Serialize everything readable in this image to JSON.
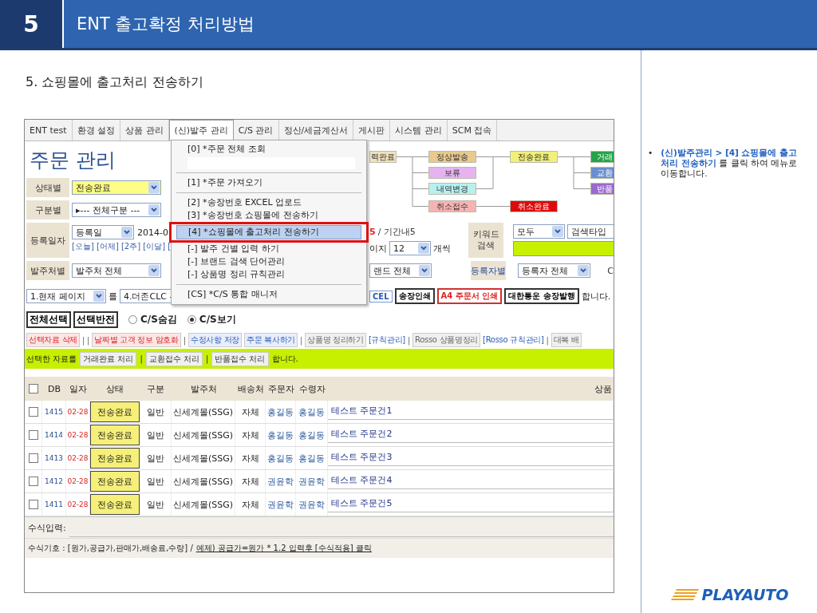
{
  "slide": {
    "number": "5",
    "title": "ENT 출고확정 처리방법"
  },
  "heading": "5. 쇼핑몰에 출고처리 전송하기",
  "app": {
    "nav_tabs": [
      {
        "label": "ENT test",
        "selected": false
      },
      {
        "label": "환경 설정",
        "selected": false
      },
      {
        "label": "상품 관리",
        "selected": false
      },
      {
        "label": "(신)발주 관리",
        "selected": true
      },
      {
        "label": "C/S 관리",
        "selected": false
      },
      {
        "label": "정산/세금계산서",
        "selected": false
      },
      {
        "label": "게시판",
        "selected": false
      },
      {
        "label": "시스템 관리",
        "selected": false
      },
      {
        "label": "SCM 접속",
        "selected": false
      }
    ],
    "page_title": "주문 관리",
    "menu": [
      {
        "kind": "item",
        "label": "[0] *주문 전체 조회",
        "selected": false
      },
      {
        "kind": "blank"
      },
      {
        "kind": "divider"
      },
      {
        "kind": "item",
        "label": "[1] *주문 가져오기",
        "selected": false
      },
      {
        "kind": "divider"
      },
      {
        "kind": "item",
        "label": "[2] *송장번호 EXCEL 업로드",
        "selected": false
      },
      {
        "kind": "item",
        "label": "[3] *송장번호 쇼핑몰에 전송하기",
        "selected": false
      },
      {
        "kind": "item",
        "label": "[4] *쇼핑몰에 출고처리 전송하기",
        "selected": true
      },
      {
        "kind": "item",
        "label": "[-] 발주 건별 입력 하기",
        "selected": false
      },
      {
        "kind": "item",
        "label": "[-] 브랜드 검색 단어관리",
        "selected": false
      },
      {
        "kind": "item",
        "label": "[-] 상품명 정리 규칙관리",
        "selected": false
      },
      {
        "kind": "divider"
      },
      {
        "kind": "item",
        "label": "[CS] *C/S 통합 매니저",
        "selected": false
      }
    ],
    "status_filter": {
      "label": "상태별",
      "value": "전송완료"
    },
    "type_filter": {
      "label": "구분별",
      "value": "▸--- 전체구분 ---"
    },
    "date_filter": {
      "label": "등록일자",
      "value": "등록일",
      "date": "2014-0",
      "shortcuts": "[오늘] [어제] [2주] [이달] ["
    },
    "vendor_filter": {
      "label": "발주처별",
      "value": "발주처 전체"
    },
    "page_action": {
      "scope": "1.현재 페이지",
      "particle": "를",
      "target": "4.더존CLC -"
    },
    "flow": [
      [
        {
          "label": "력완료",
          "color": "#f1e2bd",
          "kind": "main"
        }
      ],
      [
        {
          "label": "정상발송",
          "color": "#e8c98e",
          "kind": "main"
        },
        {
          "label": "보류",
          "color": "#e6b3f0",
          "kind": "main"
        },
        {
          "label": "내역변경",
          "color": "#b8f0f0",
          "kind": "main"
        },
        {
          "label": "취소접수",
          "color": "#f7b3b3",
          "kind": "cancel"
        }
      ],
      [
        {
          "label": "전송완료",
          "color": "#f2f07a",
          "kind": "main"
        },
        {
          "label": "취소완료",
          "color": "#dd0a0a",
          "kind": "cancel"
        }
      ],
      [
        {
          "label": "거래",
          "color": "#22a548",
          "kind": "main"
        },
        {
          "label": "교환",
          "color": "#6a8fd0",
          "kind": "main"
        },
        {
          "label": "반품",
          "color": "#9b6ad0",
          "kind": "main"
        }
      ]
    ],
    "summary": {
      "count": "5",
      "period": "/ 기간내5"
    },
    "per_page": {
      "prefix": "이지",
      "value": "12",
      "suffix": "개씩"
    },
    "keyword": {
      "label": "키워드 검색",
      "scope": "모두",
      "type": "검색타입"
    },
    "brand_filter": {
      "value": "랜드 전체"
    },
    "registrant_filter": {
      "label": "등록자별",
      "value": "등록자 전체",
      "extra": "C"
    },
    "print_buttons": [
      {
        "label": "CEL",
        "kind": "link"
      },
      {
        "label": "송장인쇄",
        "kind": "print"
      },
      {
        "label": "A4 주문서 인쇄",
        "kind": "alert"
      },
      {
        "label": "대한통운 송장발행",
        "kind": "print"
      }
    ],
    "print_suffix": "합니다.",
    "select_buttons": [
      "전체선택",
      "선택반전"
    ],
    "cs_radios": [
      {
        "label": "C/S숨김",
        "selected": false
      },
      {
        "label": "C/S보기",
        "selected": true
      }
    ],
    "actions": [
      {
        "label": "선택자료 삭제",
        "kind": "danger"
      },
      {
        "label": "| |",
        "kind": "separator"
      },
      {
        "label": "날짜별 고객 정보 암호화",
        "kind": "danger"
      },
      {
        "label": "|",
        "kind": "separator"
      },
      {
        "label": "수정사항 저장",
        "kind": "primary"
      },
      {
        "label": "주문 복사하기",
        "kind": "primary"
      },
      {
        "label": "|",
        "kind": "separator"
      },
      {
        "label": "상품명 정리하기",
        "kind": "plain"
      },
      {
        "label": "[규칙관리]",
        "kind": "link"
      },
      {
        "label": "|",
        "kind": "separator"
      },
      {
        "label": "Rosso 상품명정리",
        "kind": "plain"
      },
      {
        "label": "[Rosso 규칙관리]",
        "kind": "link"
      },
      {
        "label": "|",
        "kind": "separator"
      },
      {
        "label": "대복 배",
        "kind": "plain"
      }
    ],
    "bulk_bar": [
      {
        "label": "선택한 자료를",
        "kind": "text"
      },
      {
        "label": "거래완료 처리",
        "kind": "button"
      },
      {
        "label": "|",
        "kind": "separator"
      },
      {
        "label": "교환접수 처리",
        "kind": "button"
      },
      {
        "label": "|",
        "kind": "separator"
      },
      {
        "label": "반품접수 처리",
        "kind": "button"
      },
      {
        "label": "합니다.",
        "kind": "text"
      }
    ],
    "table": {
      "all_checked": false,
      "columns": [
        "DB",
        "일자",
        "상태",
        "구분",
        "발주처",
        "배송처",
        "주문자",
        "수령자",
        "상품"
      ],
      "rows": [
        {
          "checked": false,
          "db": "1415",
          "date": "02-28",
          "status": "전송완료",
          "type": "일반",
          "vendor": "신세계몰(SSG)",
          "ship": "자체",
          "orderer": "홍길동",
          "recipient": "홍길동",
          "product": "테스트 주문건1"
        },
        {
          "checked": false,
          "db": "1414",
          "date": "02-28",
          "status": "전송완료",
          "type": "일반",
          "vendor": "신세계몰(SSG)",
          "ship": "자체",
          "orderer": "홍길동",
          "recipient": "홍길동",
          "product": "테스트 주문건2"
        },
        {
          "checked": false,
          "db": "1413",
          "date": "02-28",
          "status": "전송완료",
          "type": "일반",
          "vendor": "신세계몰(SSG)",
          "ship": "자체",
          "orderer": "홍길동",
          "recipient": "홍길동",
          "product": "테스트 주문건3"
        },
        {
          "checked": false,
          "db": "1412",
          "date": "02-28",
          "status": "전송완료",
          "type": "일반",
          "vendor": "신세계몰(SSG)",
          "ship": "자체",
          "orderer": "권윤학",
          "recipient": "권윤학",
          "product": "테스트 주문건4"
        },
        {
          "checked": false,
          "db": "1411",
          "date": "02-28",
          "status": "전송완료",
          "type": "일반",
          "vendor": "신세계몰(SSG)",
          "ship": "자체",
          "orderer": "권윤학",
          "recipient": "권윤학",
          "product": "테스트 주문건5"
        }
      ]
    },
    "formula": {
      "input_label": "수식입력:",
      "hint": "수식기호 : [원가,공급가,판매가,배송료,수량] /",
      "example": "예제) 공급가=원가 * 1.2 입력후 [수식적용] 클릭"
    }
  },
  "note": {
    "bullet": "•",
    "text": "**(신)발주관리 > [4] 쇼핑몰에 출고처리 전송하기** 를 클릭 하여 메뉴로 이동합니다."
  },
  "logo": "PLAYAUTO"
}
